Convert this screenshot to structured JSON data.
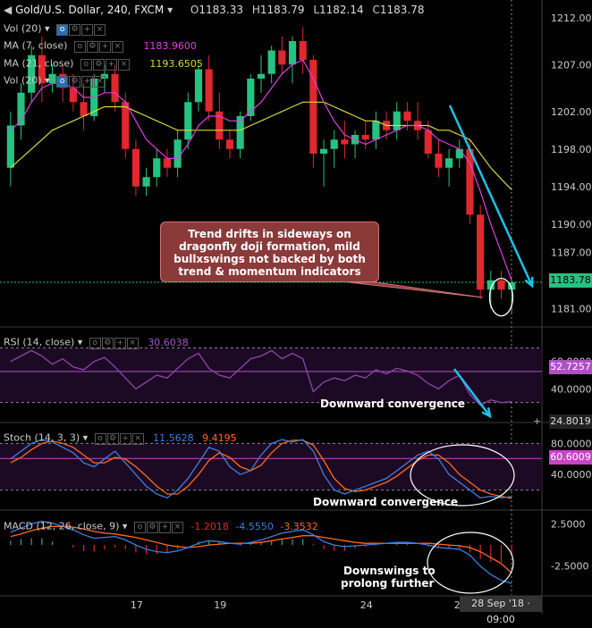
{
  "header": {
    "symbol": "Gold/U.S. Dollar, 240, FXCM",
    "open_label": "O",
    "open": "1183.33",
    "high_label": "H",
    "high": "1183.79",
    "low_label": "L",
    "low": "1182.14",
    "close_label": "C",
    "close": "1183.78"
  },
  "legends": {
    "vol1": "Vol (20)",
    "ma7": "MA (7, close)",
    "ma7_val": "1183.9600",
    "ma21": "MA (21, close)",
    "ma21_val": "1193.6505",
    "vol2": "Vol (20)",
    "rsi": "RSI (14, close)",
    "rsi_val": "30.6038",
    "stoch": "Stoch (14, 3, 3)",
    "stoch_k": "11.5628",
    "stoch_d": "9.4195",
    "macd": "MACD (12, 26, close, 9)",
    "macd_a": "-1.2018",
    "macd_b": "-4.5550",
    "macd_c": "-3.3532"
  },
  "annotations": {
    "callout": "Trend drifts in sideways on dragonfly doji formation, mild bullxswings not backed by both trend & momentum indicators",
    "rsi_note": "Downward convergence",
    "stoch_note": "Downward convergence",
    "macd_note_1": "Downswings to",
    "macd_note_2": "prolong further"
  },
  "tags": {
    "price_last": "1183.78",
    "rsi_tag": "52.7257",
    "rsi_bottom": "24.8019",
    "stoch_tag": "60.6009",
    "time_tag": "28 Sep '18 · 09:00"
  },
  "colors": {
    "up": "#26c281",
    "down": "#e0282e",
    "ma7": "#e040e0",
    "ma21": "#d9d93a",
    "rsi": "#8e44ad",
    "stoch_k": "#3d7fe0",
    "stoch_d": "#ff6a1a",
    "arrow": "#1fc0e8"
  },
  "chart_data": [
    {
      "type": "candlestick",
      "title": "Gold/U.S. Dollar, 240, FXCM",
      "x_ticks": [
        "17",
        "19",
        "24",
        "26"
      ],
      "y_ticks": [
        "1212.00",
        "1207.00",
        "1202.00",
        "1198.00",
        "1194.00",
        "1190.00",
        "1187.00",
        "1184.00",
        "1181.00"
      ],
      "ylim": [
        1179.5,
        1213.5
      ],
      "last_price": 1183.78,
      "candles": [
        [
          1196,
          1202,
          1194,
          1200.5
        ],
        [
          1200.5,
          1205,
          1199,
          1204
        ],
        [
          1204,
          1209,
          1203,
          1208
        ],
        [
          1208,
          1210,
          1203,
          1205
        ],
        [
          1205,
          1207,
          1204,
          1206
        ],
        [
          1206,
          1207,
          1203,
          1204.5
        ],
        [
          1204.5,
          1206,
          1202,
          1203
        ],
        [
          1203,
          1205,
          1200,
          1201.5
        ],
        [
          1201.5,
          1206,
          1201,
          1205.5
        ],
        [
          1205.5,
          1207,
          1204,
          1206
        ],
        [
          1206,
          1207,
          1202,
          1203
        ],
        [
          1203,
          1204,
          1197,
          1198
        ],
        [
          1198,
          1199,
          1193,
          1194
        ],
        [
          1194,
          1196,
          1193,
          1195
        ],
        [
          1195,
          1198,
          1194,
          1197
        ],
        [
          1197,
          1198,
          1195,
          1196
        ],
        [
          1196,
          1200,
          1195,
          1199
        ],
        [
          1199,
          1204,
          1198,
          1203
        ],
        [
          1203,
          1207,
          1202,
          1206.5
        ],
        [
          1206.5,
          1208,
          1201,
          1202
        ],
        [
          1202,
          1204,
          1198,
          1199
        ],
        [
          1199,
          1200,
          1197,
          1198
        ],
        [
          1198,
          1202,
          1197,
          1201.5
        ],
        [
          1201.5,
          1206,
          1201,
          1205.5
        ],
        [
          1205.5,
          1208,
          1204,
          1206
        ],
        [
          1206,
          1209,
          1205,
          1208.5
        ],
        [
          1208.5,
          1210,
          1206,
          1207
        ],
        [
          1207,
          1210,
          1205,
          1209.5
        ],
        [
          1209.5,
          1211,
          1206,
          1207.5
        ],
        [
          1207.5,
          1208,
          1196,
          1197.5
        ],
        [
          1197.5,
          1199,
          1194,
          1198
        ],
        [
          1198,
          1200,
          1196,
          1199
        ],
        [
          1199,
          1201,
          1197,
          1198.5
        ],
        [
          1198.5,
          1200,
          1197,
          1199.5
        ],
        [
          1199.5,
          1201,
          1198,
          1199
        ],
        [
          1199,
          1202,
          1198,
          1201
        ],
        [
          1201,
          1202,
          1199,
          1200
        ],
        [
          1200,
          1203,
          1199,
          1202
        ],
        [
          1202,
          1203,
          1200,
          1201
        ],
        [
          1201,
          1203,
          1199,
          1200
        ],
        [
          1200,
          1201,
          1197,
          1197.5
        ],
        [
          1197.5,
          1199,
          1195,
          1196
        ],
        [
          1196,
          1198,
          1194,
          1197
        ],
        [
          1197,
          1199,
          1196,
          1198
        ],
        [
          1198,
          1199,
          1190,
          1191
        ],
        [
          1191,
          1192,
          1182,
          1183
        ],
        [
          1183,
          1185,
          1181,
          1184
        ],
        [
          1184,
          1185,
          1182,
          1183
        ],
        [
          1183,
          1184,
          1180.5,
          1183.78
        ]
      ],
      "ma7": [
        1200,
        1201,
        1203,
        1204.5,
        1205,
        1205,
        1204.5,
        1203.5,
        1203.5,
        1204,
        1204,
        1203,
        1201,
        1199,
        1198,
        1197,
        1197,
        1198.5,
        1200.5,
        1201.5,
        1201.5,
        1201,
        1201,
        1202,
        1203,
        1204.5,
        1206,
        1207,
        1207.5,
        1205.5,
        1203,
        1201,
        1199.5,
        1199,
        1198.5,
        1199,
        1199.5,
        1200,
        1200.5,
        1200.5,
        1200,
        1199,
        1198.5,
        1198,
        1196.5,
        1193.5,
        1190,
        1187,
        1183.96
      ],
      "ma21": [
        1196,
        1197,
        1198,
        1199,
        1200,
        1200.5,
        1201,
        1201.5,
        1202,
        1202.5,
        1202.5,
        1202.5,
        1202,
        1201.5,
        1201,
        1200.5,
        1200,
        1200,
        1200,
        1200,
        1200,
        1200,
        1200,
        1200.5,
        1201,
        1201.5,
        1202,
        1202.5,
        1203,
        1203,
        1203,
        1202.5,
        1202,
        1201.5,
        1201,
        1201,
        1200.5,
        1200.5,
        1200.5,
        1200.5,
        1200.5,
        1200,
        1200,
        1199.5,
        1199,
        1197.5,
        1196,
        1194.8,
        1193.65
      ]
    },
    {
      "type": "line",
      "title": "RSI (14, close)",
      "y_ticks": [
        "60.0000",
        "40.0000"
      ],
      "ylim": [
        20,
        80
      ],
      "levels": [
        70,
        30
      ],
      "series": [
        {
          "name": "RSI",
          "values": [
            60,
            64,
            68,
            64,
            58,
            62,
            56,
            54,
            60,
            63,
            56,
            48,
            40,
            45,
            50,
            48,
            55,
            62,
            66,
            55,
            50,
            48,
            55,
            62,
            64,
            68,
            62,
            66,
            62,
            38,
            45,
            48,
            46,
            50,
            48,
            54,
            51,
            55,
            53,
            50,
            44,
            40,
            46,
            50,
            36,
            28,
            32,
            30,
            30.6038
          ]
        }
      ]
    },
    {
      "type": "line",
      "title": "Stoch (14, 3, 3)",
      "y_ticks": [
        "80.0000",
        "40.0000"
      ],
      "ylim": [
        0,
        100
      ],
      "levels": [
        80,
        20
      ],
      "series": [
        {
          "name": "%K",
          "values": [
            60,
            70,
            80,
            85,
            82,
            75,
            68,
            55,
            50,
            60,
            70,
            55,
            40,
            25,
            15,
            10,
            20,
            35,
            55,
            75,
            70,
            50,
            40,
            45,
            65,
            80,
            85,
            82,
            85,
            70,
            40,
            20,
            15,
            20,
            25,
            30,
            35,
            45,
            55,
            65,
            70,
            60,
            40,
            30,
            20,
            10,
            12,
            10,
            11.5628
          ]
        },
        {
          "name": "%D",
          "values": [
            55,
            62,
            72,
            80,
            83,
            80,
            75,
            65,
            55,
            55,
            62,
            60,
            50,
            38,
            25,
            15,
            15,
            25,
            40,
            58,
            68,
            62,
            50,
            45,
            52,
            68,
            80,
            84,
            84,
            78,
            58,
            35,
            22,
            18,
            20,
            25,
            30,
            38,
            48,
            58,
            65,
            65,
            55,
            40,
            30,
            20,
            15,
            12,
            9.4195
          ]
        }
      ]
    },
    {
      "type": "line",
      "title": "MACD (12, 26, close, 9)",
      "y_ticks": [
        "2.5000",
        "-2.5000"
      ],
      "ylim": [
        -5.5,
        3.5
      ],
      "series": [
        {
          "name": "MACD",
          "values": [
            1.5,
            2.0,
            2.5,
            2.8,
            2.6,
            2.2,
            1.8,
            1.2,
            0.8,
            0.9,
            1.0,
            0.6,
            0.0,
            -0.5,
            -0.8,
            -0.9,
            -0.7,
            -0.3,
            0.2,
            0.5,
            0.4,
            0.2,
            0.1,
            0.3,
            0.6,
            1.0,
            1.4,
            1.6,
            1.8,
            1.2,
            0.4,
            0.0,
            -0.2,
            -0.1,
            0.0,
            0.1,
            0.2,
            0.3,
            0.3,
            0.2,
            0.0,
            -0.3,
            -0.4,
            -0.5,
            -1.2,
            -2.5,
            -3.5,
            -4.2,
            -4.555
          ]
        },
        {
          "name": "Signal",
          "values": [
            1.0,
            1.3,
            1.7,
            2.0,
            2.2,
            2.2,
            2.1,
            1.9,
            1.6,
            1.4,
            1.3,
            1.1,
            0.9,
            0.6,
            0.3,
            0.0,
            -0.2,
            -0.3,
            -0.2,
            0.0,
            0.1,
            0.2,
            0.2,
            0.2,
            0.3,
            0.5,
            0.7,
            0.9,
            1.1,
            1.1,
            0.9,
            0.7,
            0.5,
            0.3,
            0.2,
            0.2,
            0.2,
            0.2,
            0.2,
            0.2,
            0.2,
            0.1,
            0.0,
            -0.1,
            -0.3,
            -0.8,
            -1.5,
            -2.2,
            -3.3532
          ]
        }
      ]
    }
  ]
}
